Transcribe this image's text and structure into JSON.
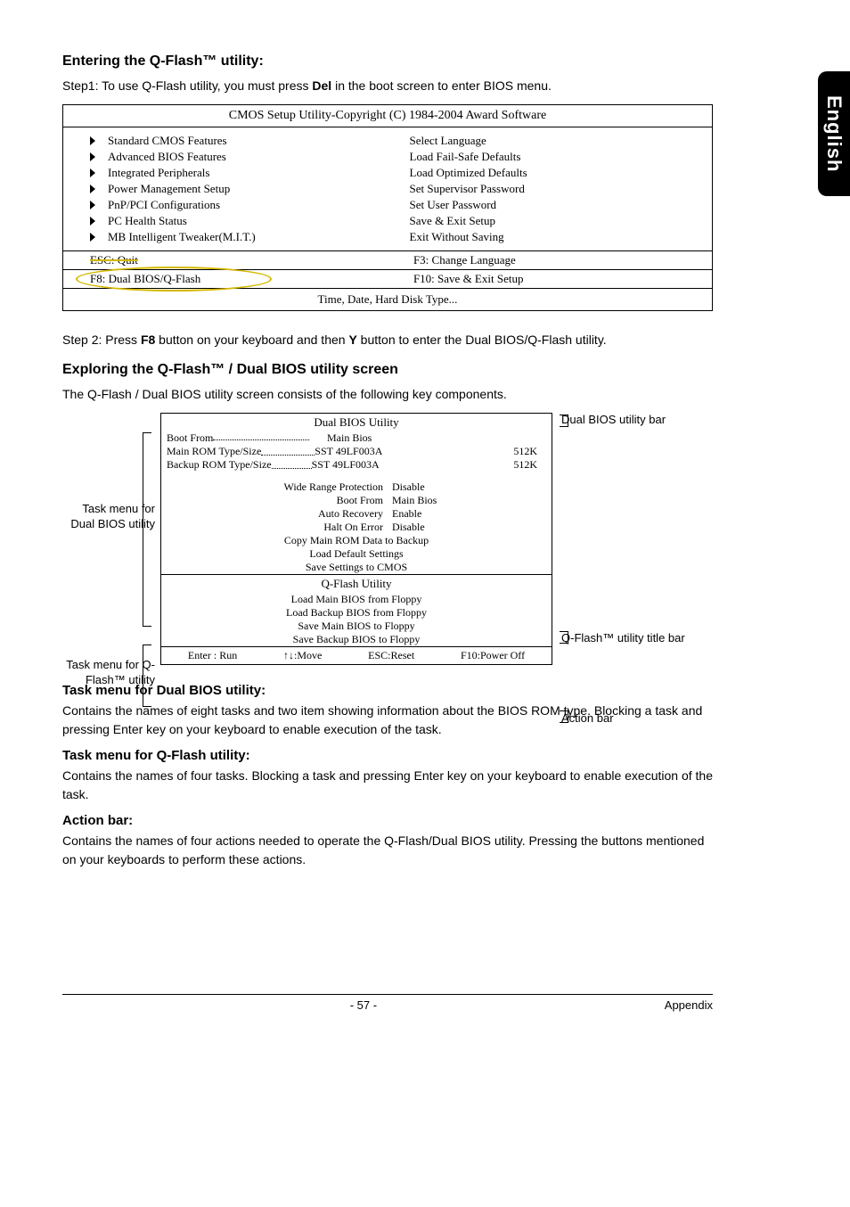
{
  "side_tab": "English",
  "heading1": "Entering the Q-Flash™ utility:",
  "step1_pre": "Step1: To use Q-Flash utility, you must press ",
  "step1_bold": "Del",
  "step1_post": " in the boot screen to enter BIOS menu.",
  "cmos": {
    "title": "CMOS Setup Utility-Copyright (C) 1984-2004 Award Software",
    "left": [
      "Standard CMOS Features",
      "Advanced BIOS Features",
      "Integrated Peripherals",
      "Power Management Setup",
      "PnP/PCI Configurations",
      "PC Health Status",
      "MB Intelligent Tweaker(M.I.T.)"
    ],
    "right": [
      "Select Language",
      "Load Fail-Safe Defaults",
      "Load Optimized Defaults",
      "Set Supervisor Password",
      "Set User Password",
      "Save & Exit Setup",
      "Exit Without Saving"
    ],
    "key_esc": "ESC: Quit",
    "key_f3": "F3: Change Language",
    "key_f8": "F8: Dual BIOS/Q-Flash",
    "key_f10": "F10: Save & Exit Setup",
    "footer": "Time, Date, Hard Disk Type..."
  },
  "step2_pre": "Step 2: Press ",
  "step2_b1": "F8",
  "step2_mid": " button on your keyboard and then ",
  "step2_b2": "Y",
  "step2_post": " button to enter the Dual BIOS/Q-Flash utility.",
  "heading2": "Exploring the Q-Flash™ / Dual BIOS utility screen",
  "explore_para": "The Q-Flash / Dual BIOS utility screen consists of the following key components.",
  "left_labels": {
    "dual": "Task menu for Dual BIOS utility",
    "qflash": "Task menu for Q-Flash™ utility"
  },
  "right_labels": {
    "dual_bar": "Dual BIOS utility bar",
    "qflash_bar": "Q-Flash™ utility title bar",
    "action_bar": "Action bar"
  },
  "dual": {
    "title": "Dual BIOS Utility",
    "boot_from_label": "Boot From",
    "boot_from_value": "Main Bios",
    "main_rom_label": "Main ROM Type/Size",
    "main_rom_chip": "SST 49LF003A",
    "main_rom_size": "512K",
    "backup_rom_label": "Backup ROM Type/Size",
    "backup_rom_chip": "SST 49LF003A",
    "backup_rom_size": "512K",
    "pairs": [
      {
        "l": "Wide Range Protection",
        "v": "Disable"
      },
      {
        "l": "Boot From",
        "v": "Main Bios"
      },
      {
        "l": "Auto Recovery",
        "v": "Enable"
      },
      {
        "l": "Halt On Error",
        "v": "Disable"
      }
    ],
    "centers": [
      "Copy Main ROM Data to Backup",
      "Load Default Settings",
      "Save Settings to CMOS"
    ]
  },
  "qflash": {
    "title": "Q-Flash Utility",
    "items": [
      "Load Main BIOS from Floppy",
      "Load Backup BIOS from Floppy",
      "Save Main BIOS to Floppy",
      "Save Backup BIOS to Floppy"
    ]
  },
  "actions": {
    "a": "Enter : Run",
    "b": "↑↓:Move",
    "c": "ESC:Reset",
    "d": "F10:Power Off"
  },
  "sec1_h": "Task menu for Dual BIOS utility:",
  "sec1_p": "Contains the names of eight tasks and two item showing information about the BIOS ROM type. Blocking a task and pressing Enter key on your keyboard to enable execution of the task.",
  "sec2_h": "Task menu for Q-Flash utility:",
  "sec2_p": "Contains the names of four tasks. Blocking a task and pressing Enter key on your keyboard to enable execution of the task.",
  "sec3_h": "Action bar:",
  "sec3_p": "Contains the names of four actions needed to operate the Q-Flash/Dual BIOS utility. Pressing the buttons mentioned on your keyboards to perform these actions.",
  "footer": {
    "page": "- 57 -",
    "section": "Appendix"
  }
}
